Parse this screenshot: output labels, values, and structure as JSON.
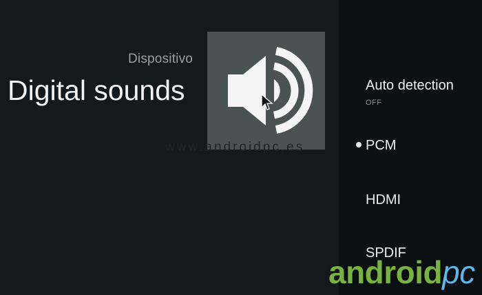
{
  "header": {
    "breadcrumb": "Dispositivo",
    "title": "Digital sounds"
  },
  "icon": {
    "name": "speaker-volume-icon"
  },
  "watermark": "www.androidpc.es",
  "options": [
    {
      "label": "Auto detection",
      "status": "OFF",
      "selected": false
    },
    {
      "label": "PCM",
      "selected": true
    },
    {
      "label": "HDMI",
      "selected": false
    },
    {
      "label": "SPDIF",
      "selected": false
    }
  ],
  "logo": {
    "main": "android",
    "accent": "pc"
  },
  "colors": {
    "background": "#131a1d",
    "panel": "#0b1013",
    "tile": "#4a5352",
    "logo_green": "#78b23f",
    "logo_blue": "#5fb6e8"
  }
}
